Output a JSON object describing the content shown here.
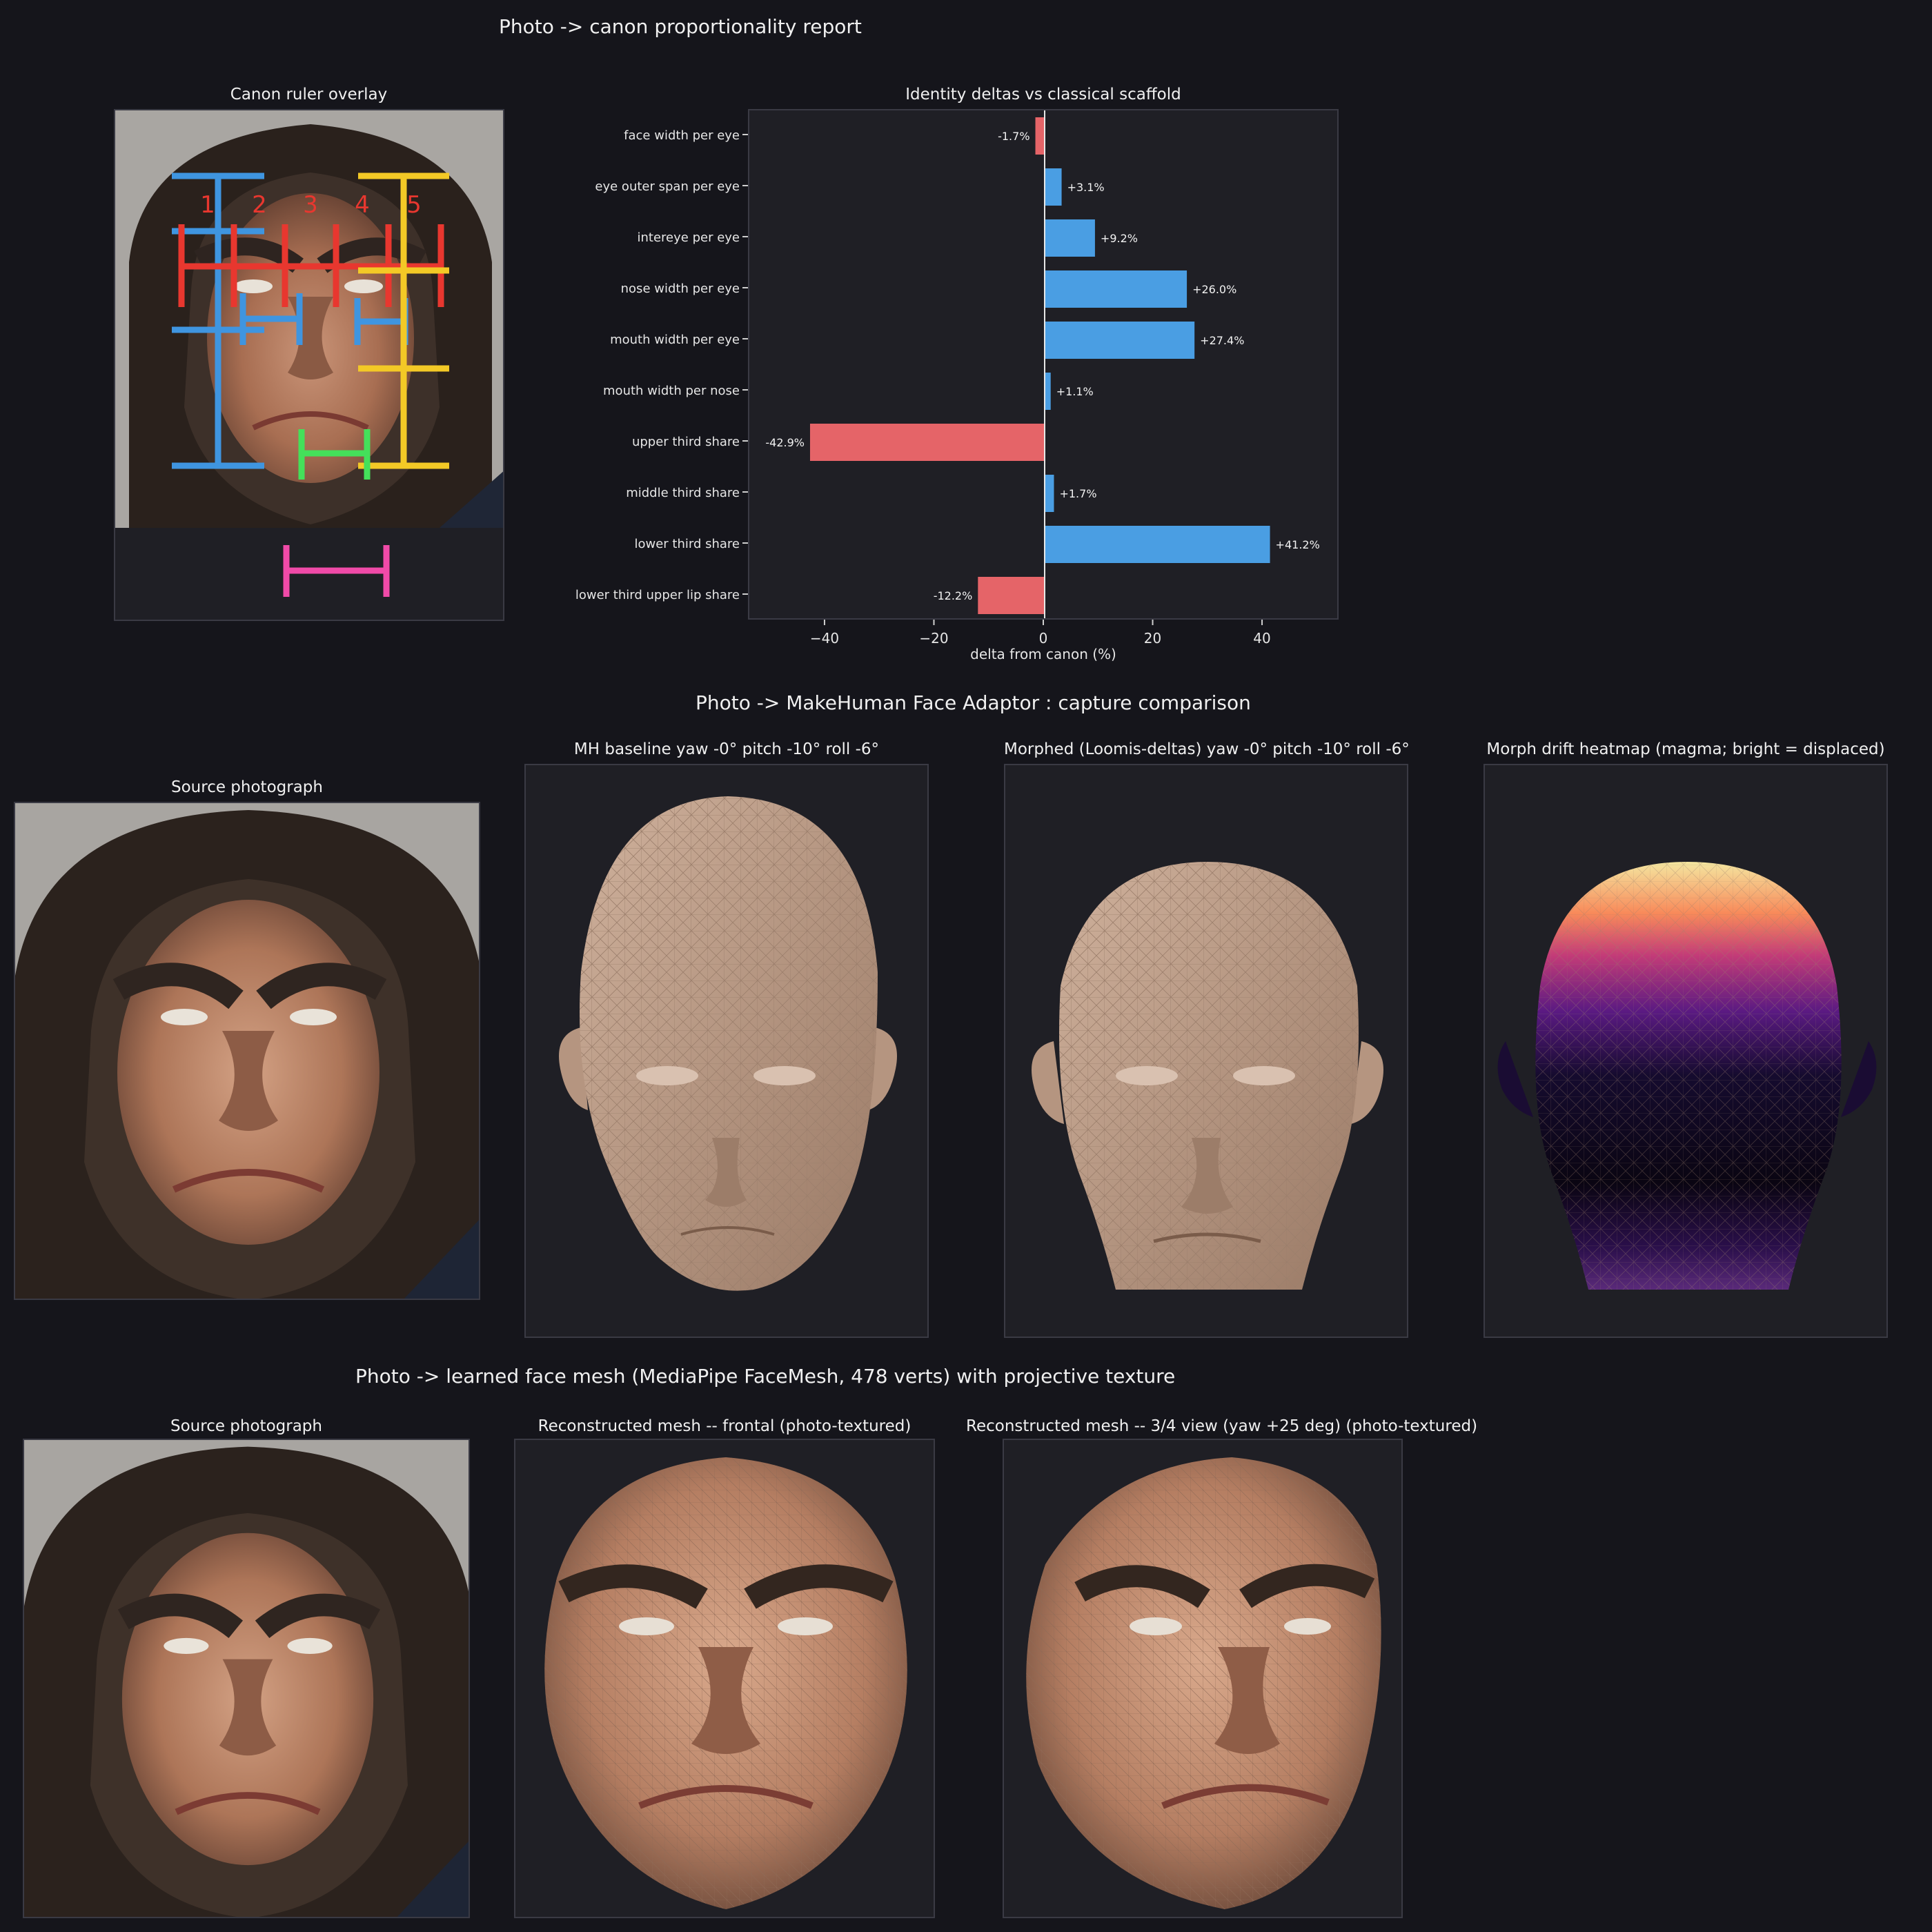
{
  "section1": {
    "title": "Photo -> canon proportionality report",
    "overlay_title": "Canon ruler overlay",
    "overlay_numbers": [
      "1",
      "2",
      "3",
      "4",
      "5"
    ],
    "chart_title": "Identity deltas vs classical scaffold"
  },
  "section2": {
    "title": "Photo -> MakeHuman Face Adaptor : capture comparison",
    "source_title": "Source photograph",
    "baseline_title": "MH baseline  yaw -0°  pitch -10°  roll -6°",
    "morphed_title": "Morphed (Loomis-deltas)  yaw -0°  pitch -10°  roll -6°",
    "heatmap_title": "Morph drift heatmap  (magma; bright = displaced)"
  },
  "section3": {
    "title": "Photo -> learned face mesh (MediaPipe FaceMesh, 478 verts) with projective texture",
    "source_title": "Source photograph",
    "frontal_title": "Reconstructed mesh -- frontal (photo-textured)",
    "three_quarter_title": "Reconstructed mesh -- 3/4 view (yaw +25 deg) (photo-textured)"
  },
  "colors": {
    "background": "#15151b",
    "panel": "#1f1f25",
    "positive": "#4a9ee3",
    "negative": "#e56468",
    "ruler_red": "#e8372f",
    "ruler_blue": "#3f95e0",
    "ruler_yellow": "#f3c926",
    "ruler_green": "#44e05a",
    "ruler_pink": "#f04aa8",
    "skin": "#c9a890"
  },
  "icons": {
    "photo": "ape-man-portrait-photo",
    "mesh": "wireframe-head-mesh"
  },
  "chart_data": {
    "type": "bar",
    "orientation": "horizontal",
    "title": "Identity deltas vs classical scaffold",
    "xlabel": "delta from canon (%)",
    "ylabel": "",
    "xlim": [
      -54,
      54
    ],
    "xticks": [
      -40,
      -20,
      0,
      20,
      40
    ],
    "xtick_labels": [
      "−40",
      "−20",
      "0",
      "20",
      "40"
    ],
    "categories": [
      "face width per eye",
      "eye outer span per eye",
      "intereye per eye",
      "nose width per eye",
      "mouth width per eye",
      "mouth width per nose",
      "upper third share",
      "middle third share",
      "lower third share",
      "lower third upper lip share"
    ],
    "values": [
      -1.7,
      3.1,
      9.2,
      26.0,
      27.4,
      1.1,
      -42.9,
      1.7,
      41.2,
      -12.2
    ],
    "value_labels": [
      "-1.7%",
      "+3.1%",
      "+9.2%",
      "+26.0%",
      "+27.4%",
      "+1.1%",
      "-42.9%",
      "+1.7%",
      "+41.2%",
      "-12.2%"
    ],
    "grid": false,
    "legend": "none"
  }
}
